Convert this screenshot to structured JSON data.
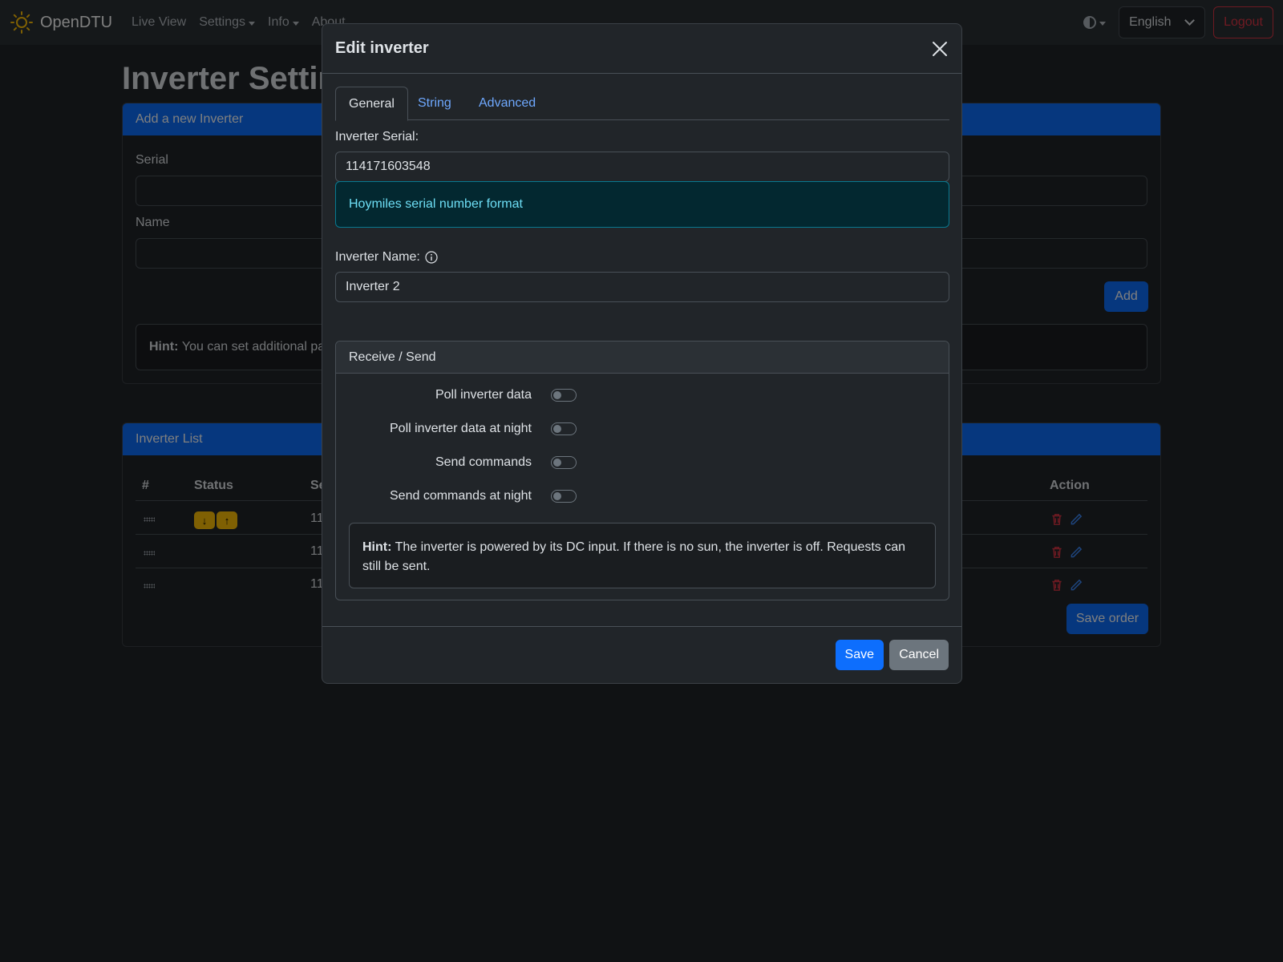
{
  "navbar": {
    "brand": "OpenDTU",
    "items": [
      {
        "label": "Live View",
        "dropdown": false
      },
      {
        "label": "Settings",
        "dropdown": true
      },
      {
        "label": "Info",
        "dropdown": true
      },
      {
        "label": "About",
        "dropdown": false
      }
    ],
    "language": "English",
    "logout": "Logout"
  },
  "page": {
    "title": "Inverter Settings",
    "add_card": {
      "header": "Add a new Inverter",
      "serial_label": "Serial",
      "name_label": "Name",
      "add_button": "Add",
      "hint_bold": "Hint:",
      "hint_text": "You can set additional pa"
    },
    "list_card": {
      "header": "Inverter List",
      "columns": [
        "#",
        "Status",
        "Se",
        "Action"
      ],
      "rows": [
        {
          "serial_partial": "11"
        },
        {
          "serial_partial": "11"
        },
        {
          "serial_partial": "11"
        }
      ],
      "status_badges": [
        "↓",
        "↑"
      ],
      "save_order": "Save order"
    }
  },
  "modal": {
    "title": "Edit inverter",
    "tabs": [
      "General",
      "String",
      "Advanced"
    ],
    "active_tab": "General",
    "serial_label": "Inverter Serial:",
    "serial_value": "114171603548",
    "serial_format": "Hoymiles serial number format",
    "name_label": "Inverter Name:",
    "name_value": "Inverter 2",
    "receive_send": {
      "header": "Receive / Send",
      "switches": [
        {
          "label": "Poll inverter data",
          "checked": false
        },
        {
          "label": "Poll inverter data at night",
          "checked": false
        },
        {
          "label": "Send commands",
          "checked": false
        },
        {
          "label": "Send commands at night",
          "checked": false
        }
      ],
      "hint_bold": "Hint:",
      "hint_text": "The inverter is powered by its DC input. If there is no sun, the inverter is off. Requests can still be sent."
    },
    "save": "Save",
    "cancel": "Cancel"
  },
  "colors": {
    "primary": "#0d6efd",
    "danger": "#dc3545",
    "warning": "#ffc107",
    "info_text": "#6edff6"
  }
}
